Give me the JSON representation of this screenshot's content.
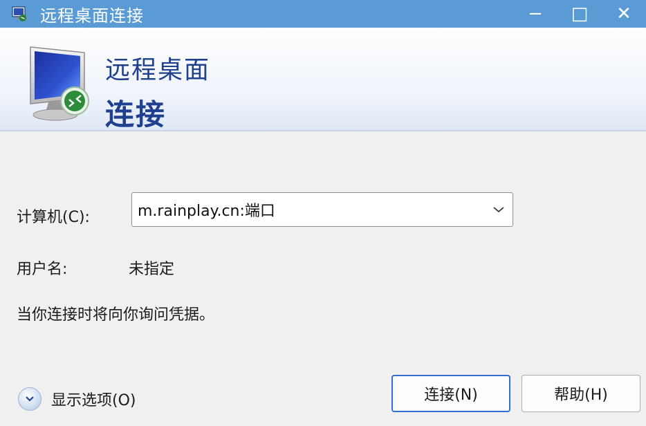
{
  "window": {
    "title": "远程桌面连接",
    "controls": {
      "minimize": "−",
      "maximize": "□",
      "close": "✕"
    }
  },
  "header": {
    "line1": "远程桌面",
    "line2": "连接",
    "icon": "remote-desktop-monitor-icon"
  },
  "form": {
    "computer_label": "计算机(C):",
    "computer_value": "m.rainplay.cn:端口",
    "username_label": "用户名:",
    "username_value": "未指定",
    "credentials_note": "当你连接时将向你询问凭据。"
  },
  "buttons": {
    "connect": "连接(N)",
    "help": "帮助(H)"
  },
  "options": {
    "label": "显示选项(O)"
  },
  "colors": {
    "titlebar": "#5b9bd5",
    "header_text": "#1f3f8f",
    "primary_border": "#2f6fcf"
  }
}
